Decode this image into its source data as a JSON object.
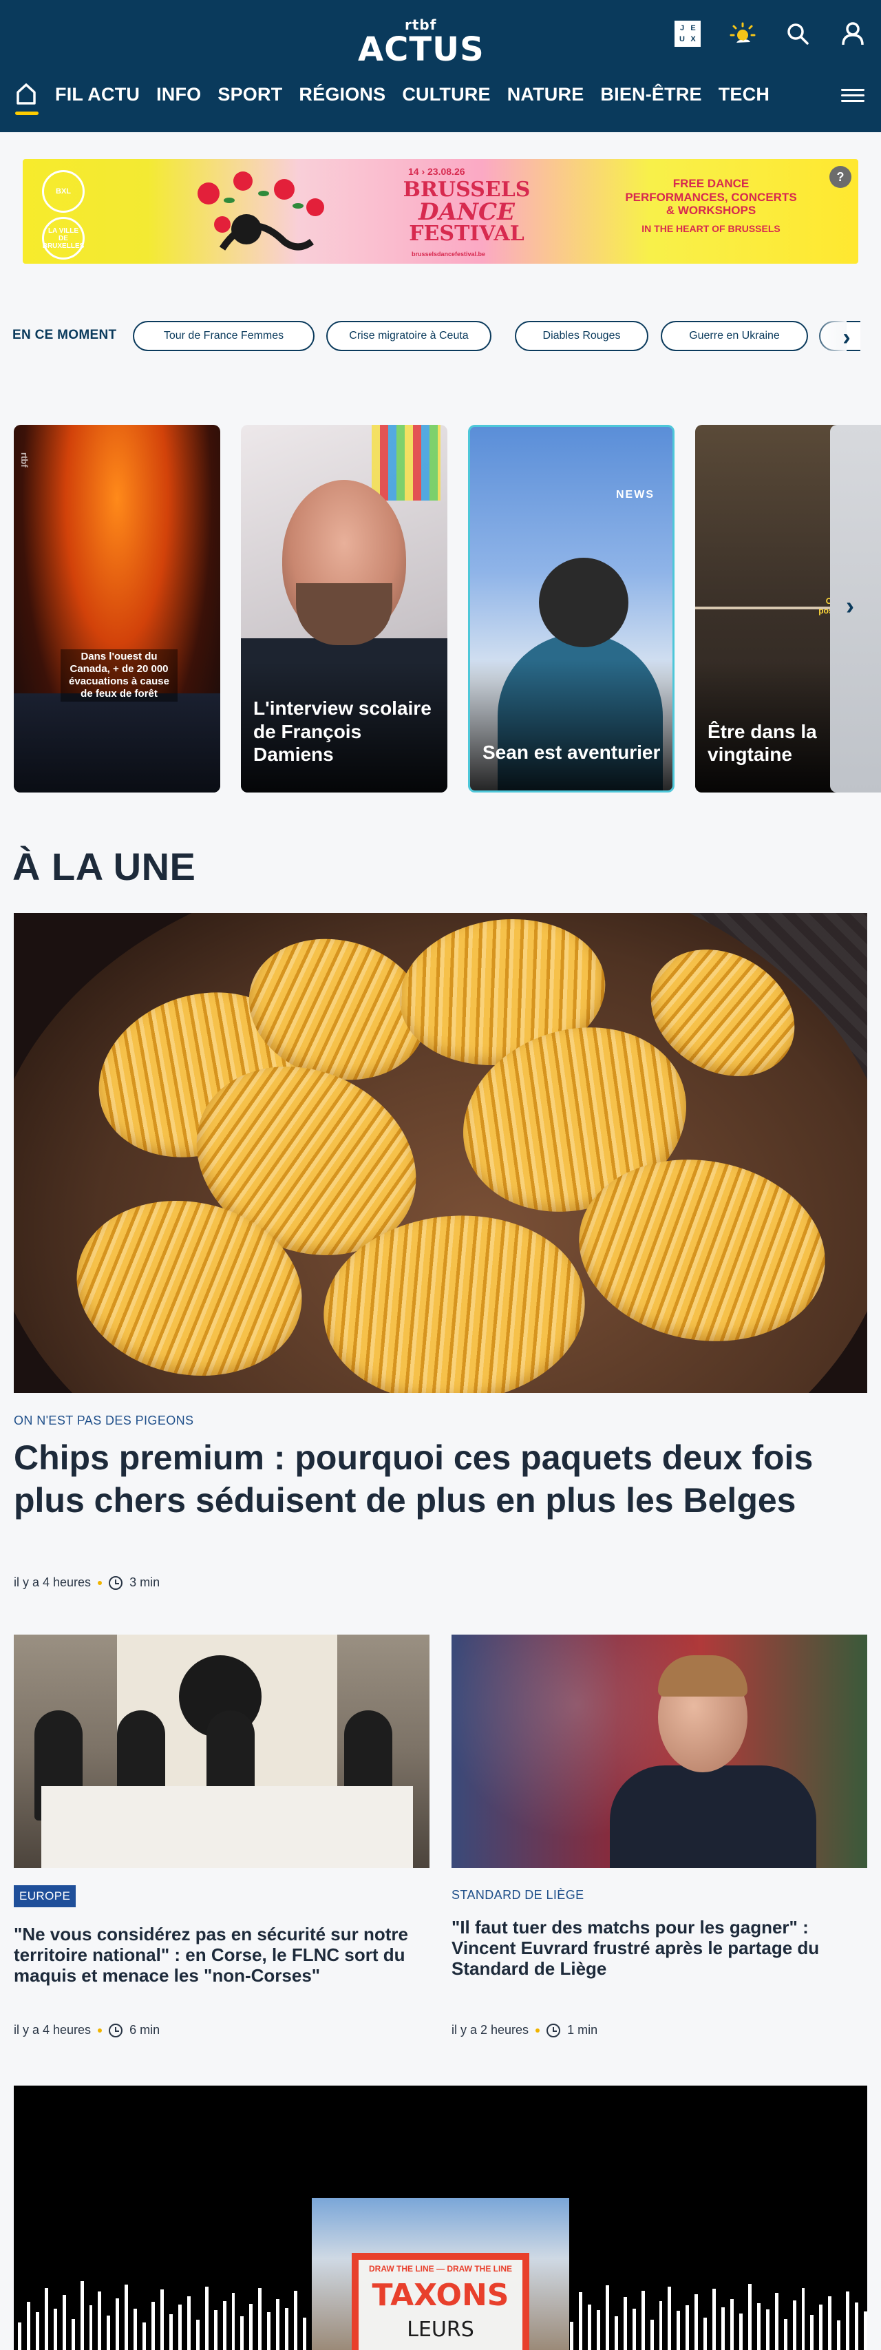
{
  "header": {
    "logo_top": "rtbf",
    "logo_main": "ACTUS",
    "icons": [
      "jeux-icon",
      "weather-sun-icon",
      "search-icon",
      "user-icon"
    ],
    "jeux_letters": [
      "J",
      "E",
      "U",
      "X"
    ]
  },
  "nav": {
    "items": [
      "FIL ACTU",
      "INFO",
      "SPORT",
      "RÉGIONS",
      "CULTURE",
      "NATURE",
      "BIEN-ÊTRE",
      "TECH"
    ],
    "active_indicator_color": "#ffcc00"
  },
  "ad": {
    "dates": "14 › 23.08.26",
    "title_line1": "BRUSSELS",
    "title_line2": "DANCE",
    "title_line3": "FESTIVAL",
    "url": "brusselsdancefestival.be",
    "tagline": "FREE DANCE PERFORMANCES, CONCERTS & WORKSHOPS",
    "tagline2": "IN THE HEART OF BRUSSELS",
    "badge1": "BXL",
    "badge2": "LA VILLE DE BRUXELLES",
    "info_icon": "?"
  },
  "moment": {
    "label": "EN CE MOMENT",
    "chips": [
      "Tour de France Femmes",
      "Crise migratoire à Ceuta",
      "Diables Rouges",
      "Guerre en Ukraine"
    ]
  },
  "stories": [
    {
      "caption": "",
      "inner_caption": "Dans l'ouest du Canada, + de 20 000 évacuations à cause de feux de forêt",
      "watermark": "rtbf"
    },
    {
      "caption": "L'interview scolaire de François Damiens"
    },
    {
      "caption": "Sean est aventurier",
      "watermark": "NEWS"
    },
    {
      "caption": "Être dans la vingtaine",
      "inner_caption": "C'est normal de se poser des questions"
    }
  ],
  "une": {
    "section_title": "À LA UNE",
    "hero": {
      "kicker": "ON N'EST PAS DES PIGEONS",
      "title": "Chips premium : pourquoi ces paquets deux fois plus chers séduisent de plus en plus les Belges",
      "time": "il y a 4 heures",
      "read": "3 min"
    },
    "articles": [
      {
        "kicker": "EUROPE",
        "title": "\"Ne vous considérez pas en sécurité sur notre territoire national\" : en Corse, le FLNC sort du maquis et menace les \"non-Corses\"",
        "time": "il y a 4 heures",
        "read": "6 min"
      },
      {
        "kicker": "STANDARD DE LIÈGE",
        "title": "\"Il faut tuer des matchs pour les gagner\" : Vincent Euvrard frustré après le partage du Standard de Liège",
        "time": "il y a 2 heures",
        "read": "1 min"
      }
    ]
  },
  "video": {
    "sign_slogan": "DRAW THE LINE — DRAW THE LINE",
    "sign_big": "TAXONS",
    "sign_small": "LEURS"
  }
}
